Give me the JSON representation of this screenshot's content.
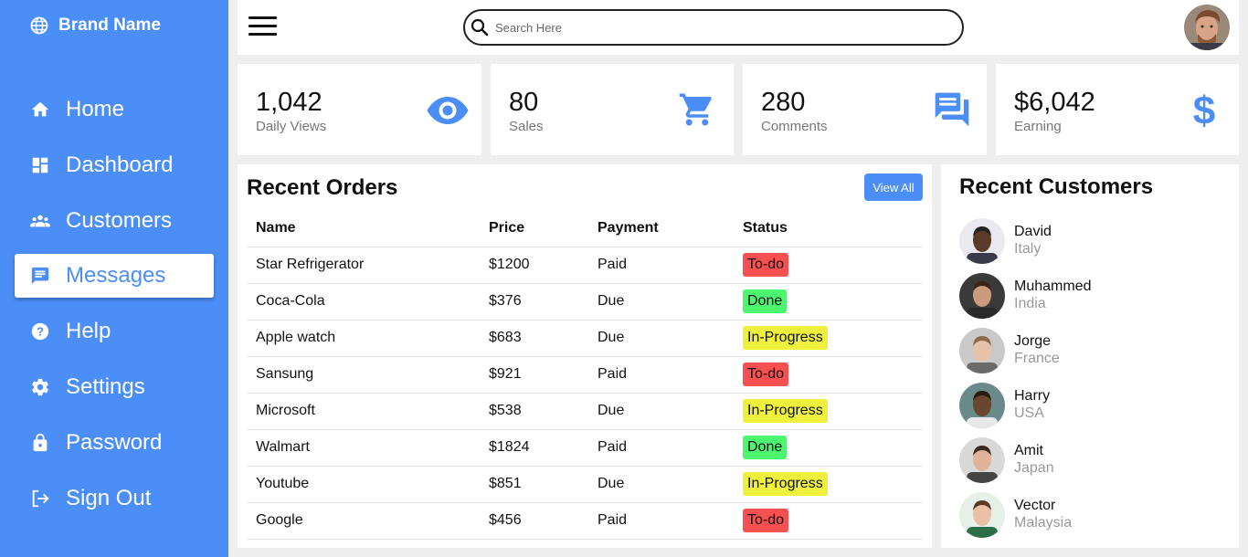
{
  "brand": {
    "name": "Brand Name",
    "icon": "globe-icon"
  },
  "nav": [
    {
      "label": "Home",
      "icon": "home-icon"
    },
    {
      "label": "Dashboard",
      "icon": "dashboard-icon"
    },
    {
      "label": "Customers",
      "icon": "people-icon"
    },
    {
      "label": "Messages",
      "icon": "message-icon",
      "active": true
    },
    {
      "label": "Help",
      "icon": "help-icon"
    },
    {
      "label": "Settings",
      "icon": "gear-icon"
    },
    {
      "label": "Password",
      "icon": "lock-icon"
    },
    {
      "label": "Sign Out",
      "icon": "sign-out-icon"
    }
  ],
  "search": {
    "placeholder": "Search Here",
    "value": ""
  },
  "cards": [
    {
      "value": "1,042",
      "label": "Daily Views",
      "icon": "eye-icon"
    },
    {
      "value": "80",
      "label": "Sales",
      "icon": "cart-icon"
    },
    {
      "value": "280",
      "label": "Comments",
      "icon": "comments-icon"
    },
    {
      "value": "$6,042",
      "label": "Earning",
      "icon": "dollar-icon"
    }
  ],
  "orders": {
    "title": "Recent Orders",
    "view_all": "View All",
    "columns": [
      "Name",
      "Price",
      "Payment",
      "Status"
    ],
    "rows": [
      {
        "name": "Star Refrigerator",
        "price": "$1200",
        "payment": "Paid",
        "status": "To-do"
      },
      {
        "name": "Coca-Cola",
        "price": "$376",
        "payment": "Due",
        "status": "Done"
      },
      {
        "name": "Apple watch",
        "price": "$683",
        "payment": "Due",
        "status": "In-Progress"
      },
      {
        "name": "Sansung",
        "price": "$921",
        "payment": "Paid",
        "status": "To-do"
      },
      {
        "name": "Microsoft",
        "price": "$538",
        "payment": "Due",
        "status": "In-Progress"
      },
      {
        "name": "Walmart",
        "price": "$1824",
        "payment": "Paid",
        "status": "Done"
      },
      {
        "name": "Youtube",
        "price": "$851",
        "payment": "Due",
        "status": "In-Progress"
      },
      {
        "name": "Google",
        "price": "$456",
        "payment": "Paid",
        "status": "To-do"
      }
    ]
  },
  "customers": {
    "title": "Recent Customers",
    "list": [
      {
        "name": "David",
        "country": "Italy"
      },
      {
        "name": "Muhammed",
        "country": "India"
      },
      {
        "name": "Jorge",
        "country": "France"
      },
      {
        "name": "Harry",
        "country": "USA"
      },
      {
        "name": "Amit",
        "country": "Japan"
      },
      {
        "name": "Vector",
        "country": "Malaysia"
      }
    ]
  },
  "colors": {
    "accent": "#4b8ef7",
    "status_todo": "#f75050",
    "status_done": "#4cf76f",
    "status_progress": "#eff03c"
  }
}
